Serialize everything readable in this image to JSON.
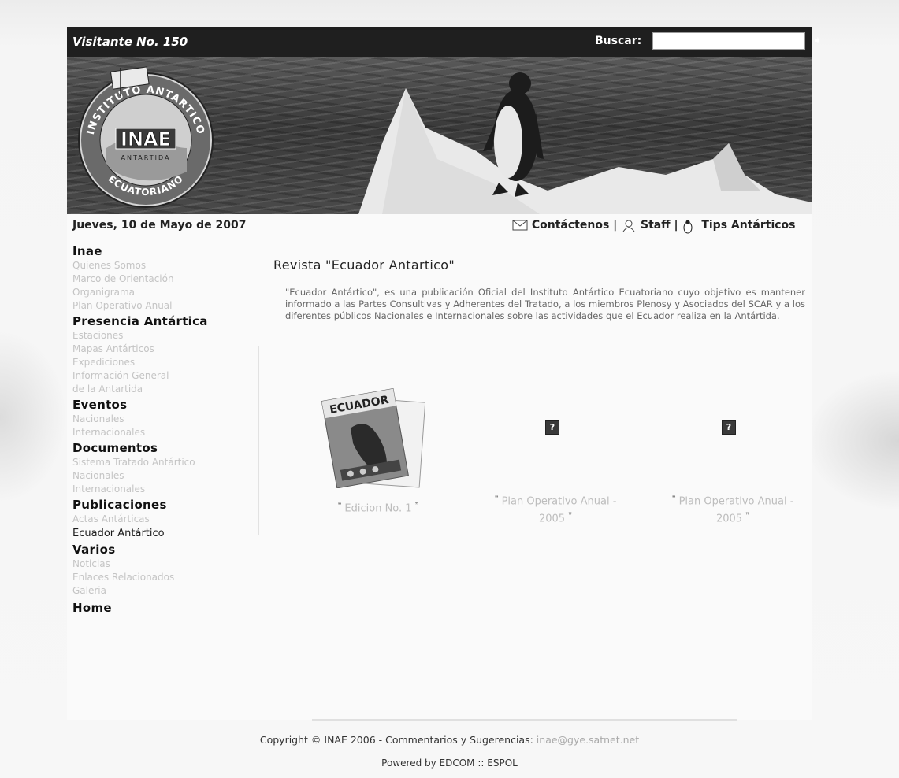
{
  "header": {
    "visitor": "Visitante No. 150",
    "search_label": "Buscar:",
    "search_value": "",
    "search_go": "➧"
  },
  "logo": {
    "top_text": "INSTITUTO ANTARTICO",
    "center": "INAE",
    "sub": "ANTARTIDA",
    "bottom_text": "ECUATORIANO"
  },
  "date": "Jueves, 10 de Mayo de 2007",
  "toplinks": {
    "contact": "Contáctenos |",
    "staff": "Staff |",
    "tips": "Tips Antárticos"
  },
  "sidebar": {
    "sections": [
      {
        "title": "Inae",
        "items": [
          "Quienes Somos",
          "Marco de Orientación",
          "Organigrama",
          "Plan Operativo Anual"
        ]
      },
      {
        "title": "Presencia Antártica",
        "items": [
          "Estaciones",
          "Mapas Antárticos",
          "Expediciones",
          "Información General",
          "de la Antartida"
        ]
      },
      {
        "title": "Eventos",
        "items": [
          "Nacionales",
          "Internacionales"
        ]
      },
      {
        "title": "Documentos",
        "items": [
          "Sistema Tratado Antártico",
          "Nacionales",
          "Internacionales"
        ]
      },
      {
        "title": "Publicaciones",
        "items": [
          "Actas Antárticas",
          "Ecuador Antártico"
        ]
      },
      {
        "title": "Varios",
        "items": [
          "Noticias",
          "Enlaces Relacionados",
          "Galeria"
        ]
      },
      {
        "title": "Home",
        "items": []
      }
    ]
  },
  "main": {
    "title": "Revista \"Ecuador Antartico\"",
    "description": "\"Ecuador Antártico\", es una publicación Oficial del Instituto Antártico Ecuatoriano cuyo objetivo es mantener informado a las Partes Consultivas y Adherentes del Tratado, a los miembros Plenosy y Asociados del SCAR y a los diferentes públicos Nacionales e Internacionales sobre las actividades que el Ecuador realiza en la Antártida.",
    "publications": [
      {
        "label": "Edicion No. 1",
        "cover_text": "ECUADOR"
      },
      {
        "label_1": "Plan Operativo Anual -",
        "label_2": "2005"
      },
      {
        "label_1": "Plan Operativo Anual -",
        "label_2": "2005"
      }
    ],
    "missing_image_glyph": "?"
  },
  "footer": {
    "copyright": "Copyright © INAE 2006 - Commentarios y Sugerencias: ",
    "email": "inae@gye.satnet.net",
    "powered": "Powered by EDCOM :: ESPOL"
  }
}
